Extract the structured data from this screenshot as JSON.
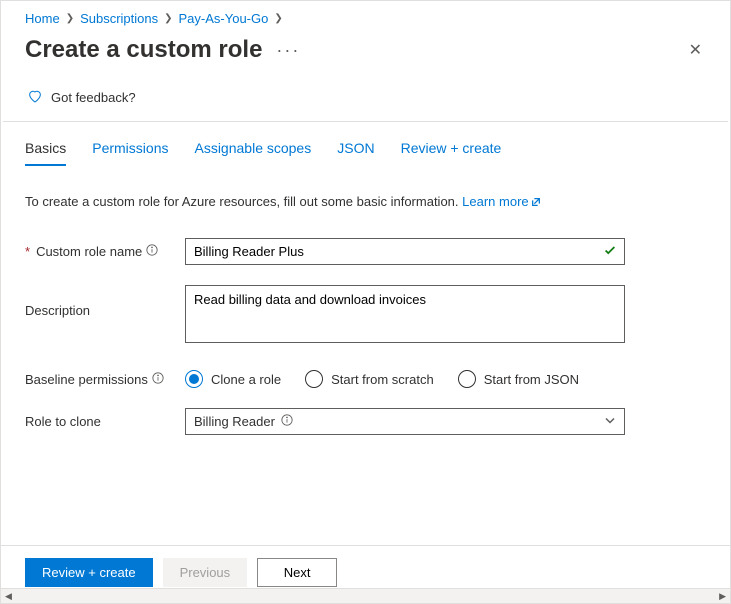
{
  "breadcrumb": {
    "items": [
      "Home",
      "Subscriptions",
      "Pay-As-You-Go"
    ]
  },
  "title": "Create a custom role",
  "feedback": {
    "label": "Got feedback?"
  },
  "tabs": {
    "items": [
      {
        "label": "Basics",
        "active": true
      },
      {
        "label": "Permissions",
        "active": false
      },
      {
        "label": "Assignable scopes",
        "active": false
      },
      {
        "label": "JSON",
        "active": false
      },
      {
        "label": "Review + create",
        "active": false
      }
    ]
  },
  "intro": {
    "text": "To create a custom role for Azure resources, fill out some basic information.",
    "link": "Learn more"
  },
  "form": {
    "role_name_label": "Custom role name",
    "role_name_value": "Billing Reader Plus",
    "description_label": "Description",
    "description_value": "Read billing data and download invoices",
    "baseline_label": "Baseline permissions",
    "baseline_options": [
      {
        "label": "Clone a role",
        "checked": true
      },
      {
        "label": "Start from scratch",
        "checked": false
      },
      {
        "label": "Start from JSON",
        "checked": false
      }
    ],
    "role_to_clone_label": "Role to clone",
    "role_to_clone_value": "Billing Reader"
  },
  "footer": {
    "review": "Review + create",
    "previous": "Previous",
    "next": "Next"
  }
}
